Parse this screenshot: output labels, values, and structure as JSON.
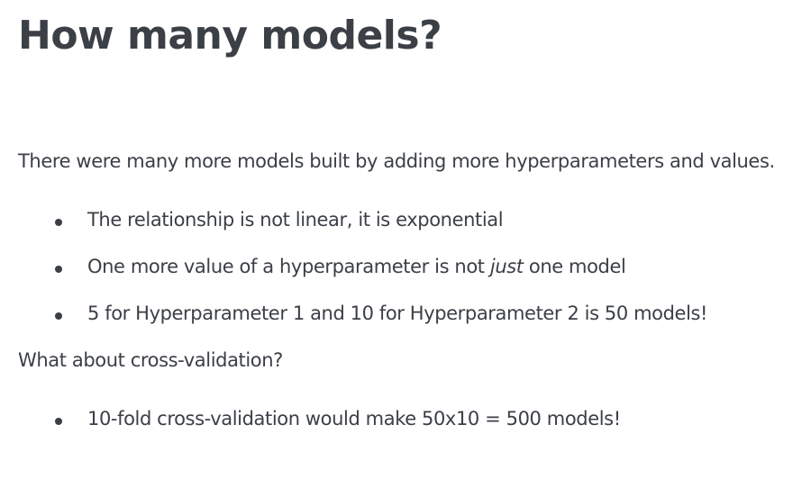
{
  "title": "How many models?",
  "intro": "There were many more models built by adding more hyperparameters and values.",
  "bullets": [
    {
      "text": "The relationship is not linear, it is exponential"
    },
    {
      "before": "One more value of a hyperparameter is not ",
      "emph": "just",
      "after": " one model"
    },
    {
      "text": "5 for Hyperparameter 1 and 10 for Hyperparameter 2 is 50 models!"
    }
  ],
  "question": "What about cross-validation?",
  "bullets2": [
    {
      "text": "10-fold cross-validation would make 50x10 = 500 models!"
    }
  ]
}
